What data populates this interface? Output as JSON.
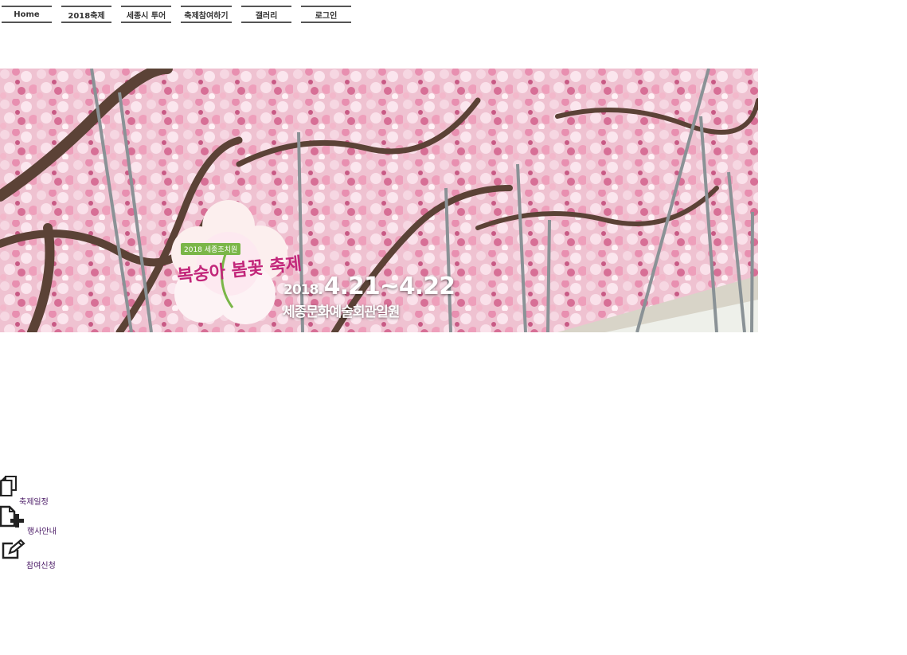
{
  "nav": {
    "items": [
      {
        "label": "Home"
      },
      {
        "label": "2018축제"
      },
      {
        "label": "세종시 투어"
      },
      {
        "label": "축제참여하기"
      },
      {
        "label": "갤러리"
      },
      {
        "label": "로그인"
      }
    ]
  },
  "banner": {
    "logo_tag": "2018 세종조치원",
    "logo_title": "복숭아 봄꽃 축제",
    "year": "2018.",
    "dates": "4.21~4.22",
    "venue": "세종문화예술회관일원"
  },
  "quick_links": [
    {
      "label": "축제일정",
      "icon": "documents-icon"
    },
    {
      "label": "행사안내",
      "icon": "document-add-icon"
    },
    {
      "label": "참여신청",
      "icon": "edit-icon"
    }
  ],
  "colors": {
    "nav_border": "#555555",
    "blossom_pink": "#f2a7c3",
    "logo_green": "#7ab648",
    "logo_magenta": "#c2267a",
    "link_text": "#4a1a66"
  }
}
